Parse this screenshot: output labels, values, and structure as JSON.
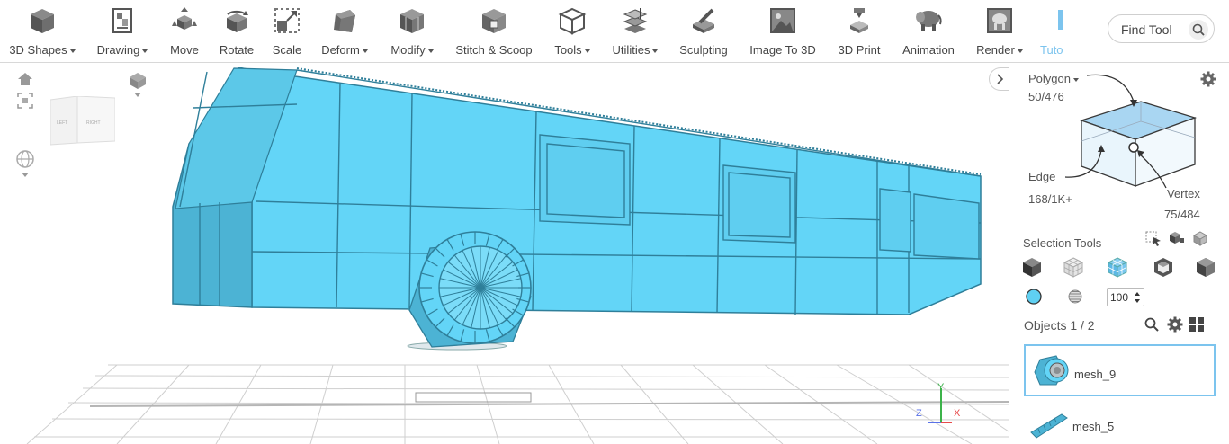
{
  "toolbar": {
    "tools": [
      {
        "label": "3D Shapes",
        "dropdown": true,
        "icon": "cube-icon"
      },
      {
        "label": "Drawing",
        "dropdown": true,
        "icon": "drawing-icon"
      },
      {
        "label": "Move",
        "dropdown": false,
        "icon": "move-icon"
      },
      {
        "label": "Rotate",
        "dropdown": false,
        "icon": "rotate-icon"
      },
      {
        "label": "Scale",
        "dropdown": false,
        "icon": "scale-icon"
      },
      {
        "label": "Deform",
        "dropdown": true,
        "icon": "deform-icon"
      },
      {
        "label": "Modify",
        "dropdown": true,
        "icon": "modify-icon"
      },
      {
        "label": "Stitch & Scoop",
        "dropdown": false,
        "icon": "stitch-scoop-icon"
      },
      {
        "label": "Tools",
        "dropdown": true,
        "icon": "tools-icon"
      },
      {
        "label": "Utilities",
        "dropdown": true,
        "icon": "utilities-icon"
      },
      {
        "label": "Sculpting",
        "dropdown": false,
        "icon": "sculpting-icon"
      },
      {
        "label": "Image To 3D",
        "dropdown": false,
        "icon": "image-to-3d-icon"
      },
      {
        "label": "3D Print",
        "dropdown": false,
        "icon": "3d-print-icon"
      },
      {
        "label": "Animation",
        "dropdown": false,
        "icon": "animation-icon"
      },
      {
        "label": "Render",
        "dropdown": true,
        "icon": "render-icon"
      },
      {
        "label": "Tuto",
        "dropdown": false,
        "icon": "tutorials-icon",
        "active": true
      }
    ],
    "find_tool_placeholder": "Find Tool"
  },
  "viewport": {
    "view_cube_labels": {
      "left": "LEFT",
      "right": "RIGHT"
    },
    "axis_labels": {
      "x": "X",
      "y": "Y",
      "z": "Z"
    },
    "mesh_color": "#63d5f7",
    "edge_color": "#2f7f9a"
  },
  "panel": {
    "polygon_label": "Polygon",
    "polygon_count": "50/476",
    "edge_label": "Edge",
    "edge_count": "168/1K+",
    "vertex_label": "Vertex",
    "vertex_count": "75/484",
    "selection_tools_label": "Selection Tools",
    "brush_size": "100",
    "objects_label": "Objects 1 / 2",
    "objects": [
      {
        "name": "mesh_9",
        "selected": true
      },
      {
        "name": "mesh_5",
        "selected": false
      }
    ],
    "accent_color": "#4aa8e6"
  }
}
